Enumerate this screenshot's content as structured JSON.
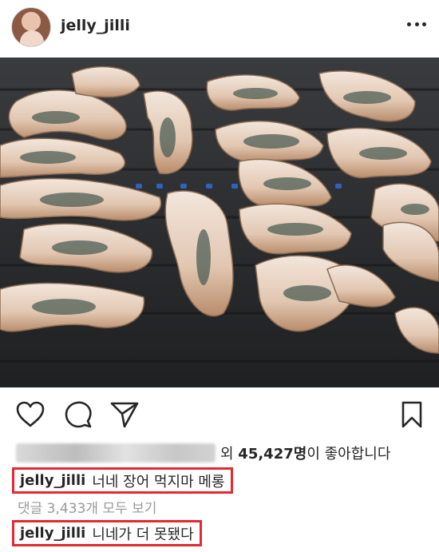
{
  "post": {
    "username": "jelly_jilli",
    "photo_alt": "",
    "likes_prefix": "외",
    "likes_count": "45,427명",
    "likes_suffix": "이 좋아합니다",
    "caption_user": "jelly_jilli",
    "caption_text": "너네 장어 먹지마 메롱",
    "view_comments_label": "댓글 3,433개 모두 보기",
    "comment_user": "jelly_jilli",
    "comment_text": "니네가 더 못됐다"
  },
  "icons": {
    "more": "more-options-icon",
    "like": "heart-icon",
    "comment": "comment-icon",
    "share": "share-icon",
    "save": "bookmark-icon"
  },
  "colors": {
    "highlight_box": "#e52933",
    "text": "#262626",
    "muted": "#999999"
  }
}
